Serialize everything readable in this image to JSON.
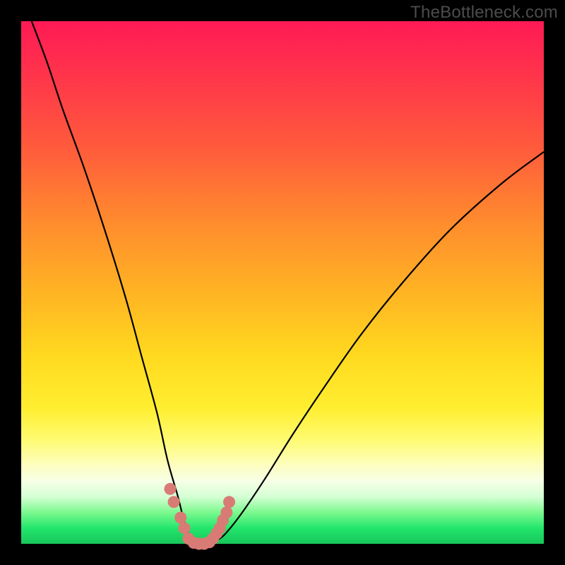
{
  "watermark": "TheBottleneck.com",
  "colors": {
    "frame": "#000000",
    "curve": "#000000",
    "marker": "#d97b75",
    "gradient_top": "#ff1a55",
    "gradient_bottom": "#17c65a"
  },
  "chart_data": {
    "type": "line",
    "title": "",
    "xlabel": "",
    "ylabel": "",
    "xlim": [
      0,
      100
    ],
    "ylim": [
      0,
      100
    ],
    "series": [
      {
        "name": "bottleneck-curve",
        "x": [
          2,
          5,
          8,
          12,
          16,
          20,
          23,
          26,
          28,
          30,
          31,
          32,
          33,
          34,
          35,
          36,
          38,
          40,
          43,
          47,
          52,
          58,
          65,
          73,
          82,
          92,
          100
        ],
        "y": [
          100,
          92,
          83,
          72,
          60,
          47,
          36,
          25,
          16,
          9,
          5,
          2,
          0.5,
          0,
          0,
          0.5,
          1,
          3,
          7,
          13,
          21,
          30,
          40,
          50,
          60,
          69,
          75
        ]
      }
    ],
    "scatter": [
      {
        "name": "sample-points",
        "x": [
          28.5,
          29.2,
          30.5,
          31.2,
          32.0,
          33.0,
          34.0,
          35.0,
          36.0,
          36.7,
          37.4,
          38.0,
          38.6,
          39.3,
          39.8
        ],
        "y": [
          10.5,
          8.0,
          5.0,
          3.0,
          1.0,
          0.2,
          0.0,
          0.0,
          0.3,
          1.0,
          2.0,
          3.0,
          4.5,
          6.0,
          8.0
        ]
      }
    ]
  }
}
